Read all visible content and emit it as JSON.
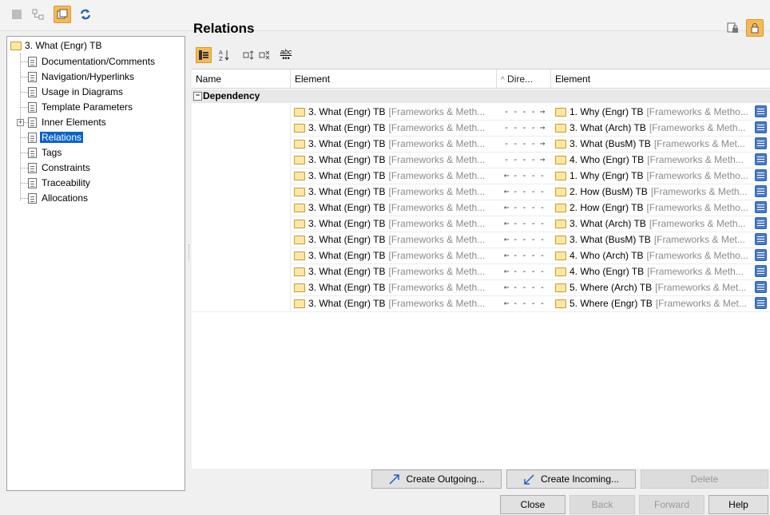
{
  "toolbar": {
    "icons": [
      "grid-icon",
      "tree-structure-icon",
      "window-copy-icon",
      "refresh-icon"
    ],
    "right_icons": [
      "lock-document-icon",
      "lock-icon"
    ]
  },
  "tree": {
    "root_label": "3. What (Engr) TB",
    "items": [
      {
        "label": "Documentation/Comments"
      },
      {
        "label": "Navigation/Hyperlinks"
      },
      {
        "label": "Usage in Diagrams"
      },
      {
        "label": "Template Parameters"
      },
      {
        "label": "Inner Elements"
      },
      {
        "label": "Relations"
      },
      {
        "label": "Tags"
      },
      {
        "label": "Constraints"
      },
      {
        "label": "Traceability"
      },
      {
        "label": "Allocations"
      }
    ],
    "selected": "Relations"
  },
  "panel": {
    "title": "Relations",
    "toolbar_icons": [
      "group-icon",
      "sort-az-icon",
      "expand-icon",
      "collapse-icon",
      "abc-icon"
    ],
    "abc_label": "abc"
  },
  "grid": {
    "columns": [
      "Name",
      "Element",
      "Dire...",
      "Element"
    ],
    "group_label": "Dependency",
    "rows": [
      {
        "src": "3. What (Engr) TB",
        "src_owner": "[Frameworks & Meth...",
        "dir": "- - - - →",
        "tgt": "1. Why (Engr) TB",
        "tgt_owner": "[Frameworks & Metho..."
      },
      {
        "src": "3. What (Engr) TB",
        "src_owner": "[Frameworks & Meth...",
        "dir": "- - - - →",
        "tgt": "3. What (Arch) TB",
        "tgt_owner": "[Frameworks & Meth..."
      },
      {
        "src": "3. What (Engr) TB",
        "src_owner": "[Frameworks & Meth...",
        "dir": "- - - - →",
        "tgt": "3. What (BusM) TB",
        "tgt_owner": "[Frameworks & Met..."
      },
      {
        "src": "3. What (Engr) TB",
        "src_owner": "[Frameworks & Meth...",
        "dir": "- - - - →",
        "tgt": "4. Who (Engr) TB",
        "tgt_owner": "[Frameworks & Meth..."
      },
      {
        "src": "3. What (Engr) TB",
        "src_owner": "[Frameworks & Meth...",
        "dir": "← - - - -",
        "tgt": "1. Why (Engr) TB",
        "tgt_owner": "[Frameworks & Metho..."
      },
      {
        "src": "3. What (Engr) TB",
        "src_owner": "[Frameworks & Meth...",
        "dir": "← - - - -",
        "tgt": "2. How (BusM) TB",
        "tgt_owner": "[Frameworks & Meth..."
      },
      {
        "src": "3. What (Engr) TB",
        "src_owner": "[Frameworks & Meth...",
        "dir": "← - - - -",
        "tgt": "2. How (Engr) TB",
        "tgt_owner": "[Frameworks & Metho..."
      },
      {
        "src": "3. What (Engr) TB",
        "src_owner": "[Frameworks & Meth...",
        "dir": "← - - - -",
        "tgt": "3. What (Arch) TB",
        "tgt_owner": "[Frameworks & Meth..."
      },
      {
        "src": "3. What (Engr) TB",
        "src_owner": "[Frameworks & Meth...",
        "dir": "← - - - -",
        "tgt": "3. What (BusM) TB",
        "tgt_owner": "[Frameworks & Met..."
      },
      {
        "src": "3. What (Engr) TB",
        "src_owner": "[Frameworks & Meth...",
        "dir": "← - - - -",
        "tgt": "4. Who (Arch) TB",
        "tgt_owner": "[Frameworks & Metho..."
      },
      {
        "src": "3. What (Engr) TB",
        "src_owner": "[Frameworks & Meth...",
        "dir": "← - - - -",
        "tgt": "4. Who (Engr) TB",
        "tgt_owner": "[Frameworks & Meth..."
      },
      {
        "src": "3. What (Engr) TB",
        "src_owner": "[Frameworks & Meth...",
        "dir": "← - - - -",
        "tgt": "5. Where (Arch) TB",
        "tgt_owner": "[Frameworks & Met..."
      },
      {
        "src": "3. What (Engr) TB",
        "src_owner": "[Frameworks & Meth...",
        "dir": "← - - - -",
        "tgt": "5. Where (Engr) TB",
        "tgt_owner": "[Frameworks & Met..."
      }
    ]
  },
  "actions": {
    "create_outgoing": "Create Outgoing...",
    "create_incoming": "Create Incoming...",
    "delete": "Delete"
  },
  "dialog_buttons": {
    "close": "Close",
    "back": "Back",
    "forward": "Forward",
    "help": "Help"
  }
}
